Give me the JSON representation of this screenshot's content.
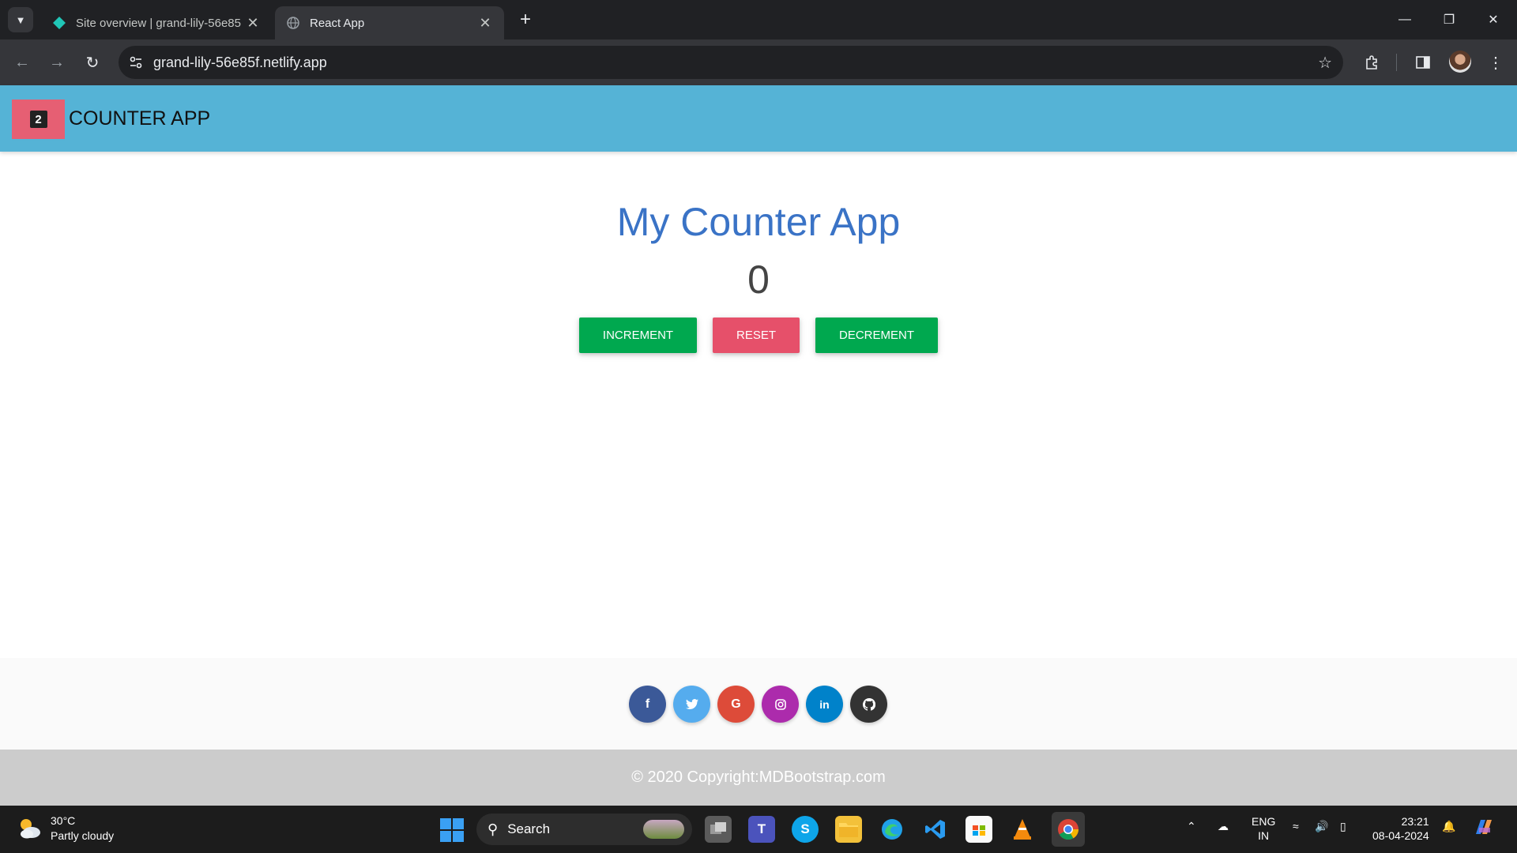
{
  "browser": {
    "tabs": [
      {
        "title": "Site overview | grand-lily-56e85",
        "active": false
      },
      {
        "title": "React App",
        "active": true
      }
    ],
    "url": "grand-lily-56e85f.netlify.app"
  },
  "navbar": {
    "brand_icon_text": "2",
    "brand_text": "COUNTER APP"
  },
  "main": {
    "title": "My Counter App",
    "count": "0",
    "buttons": {
      "increment": "INCREMENT",
      "reset": "RESET",
      "decrement": "DECREMENT"
    }
  },
  "footer": {
    "social": [
      {
        "name": "facebook",
        "glyph": "f",
        "color": "#3b5998"
      },
      {
        "name": "twitter",
        "glyph": "🐦",
        "color": "#55acee"
      },
      {
        "name": "google",
        "glyph": "G",
        "color": "#dd4b39"
      },
      {
        "name": "instagram",
        "glyph": "◎",
        "color": "#ac2bac"
      },
      {
        "name": "linkedin",
        "glyph": "in",
        "color": "#0082ca"
      },
      {
        "name": "github",
        "glyph": "●",
        "color": "#333333"
      }
    ],
    "copyright": "© 2020 Copyright:MDBootstrap.com"
  },
  "taskbar": {
    "weather_temp": "30°C",
    "weather_desc": "Partly cloudy",
    "search_label": "Search",
    "lang_top": "ENG",
    "lang_bottom": "IN",
    "time": "23:21",
    "date": "08-04-2024"
  }
}
